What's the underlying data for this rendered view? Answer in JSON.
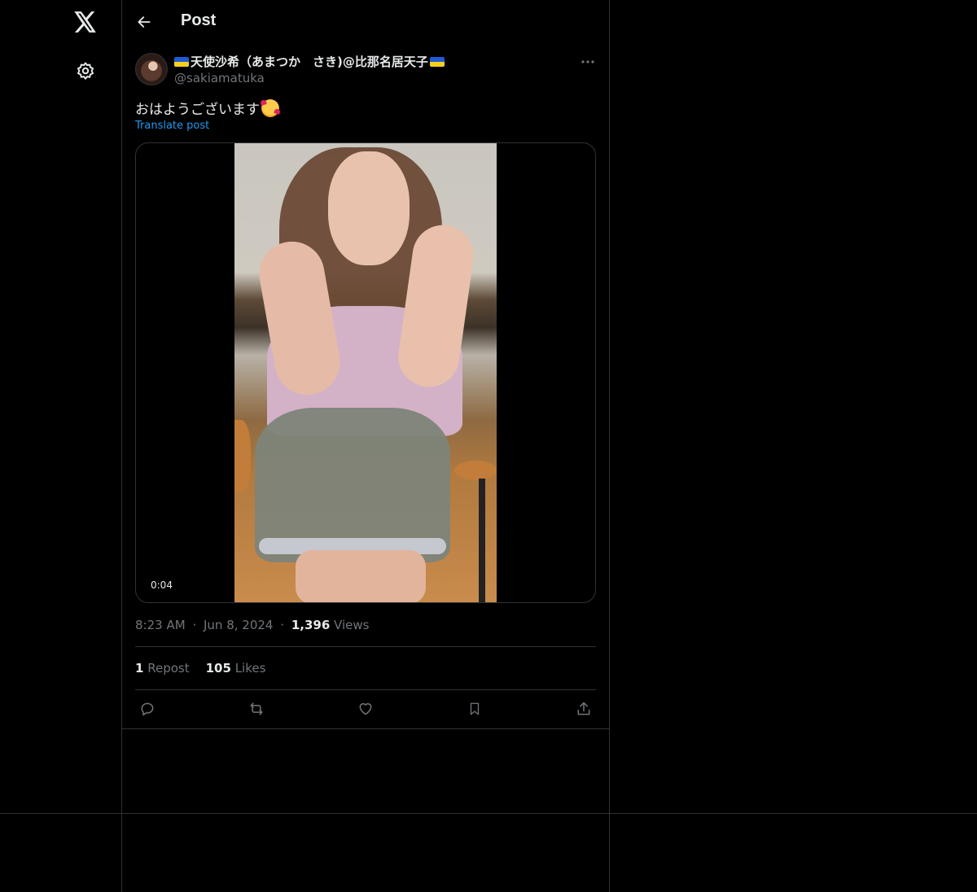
{
  "app": {
    "brand": "X"
  },
  "header": {
    "title": "Post"
  },
  "post": {
    "author": {
      "name": "天使沙希（あまつか　さき)@比那名居天子",
      "handle": "@sakiamatuka"
    },
    "text": "おはようございます",
    "translate_label": "Translate post",
    "media": {
      "type": "video",
      "duration": "0:04"
    },
    "meta": {
      "time": "8:23 AM",
      "separator": "·",
      "date": "Jun 8, 2024",
      "views_count": "1,396",
      "views_label": "Views"
    },
    "stats": {
      "reposts_count": "1",
      "reposts_label": "Repost",
      "likes_count": "105",
      "likes_label": "Likes"
    }
  },
  "icons": {
    "logo": "x-logo-icon",
    "settings": "gear-icon",
    "back": "arrow-left-icon",
    "more": "more-horizontal-icon",
    "reply": "reply-icon",
    "repost": "repost-icon",
    "like": "heart-icon",
    "bookmark": "bookmark-icon",
    "share": "share-icon"
  },
  "colors": {
    "background": "#000000",
    "text": "#e7e9ea",
    "muted": "#71767b",
    "link": "#1d9bf0",
    "border": "#2f3336"
  }
}
